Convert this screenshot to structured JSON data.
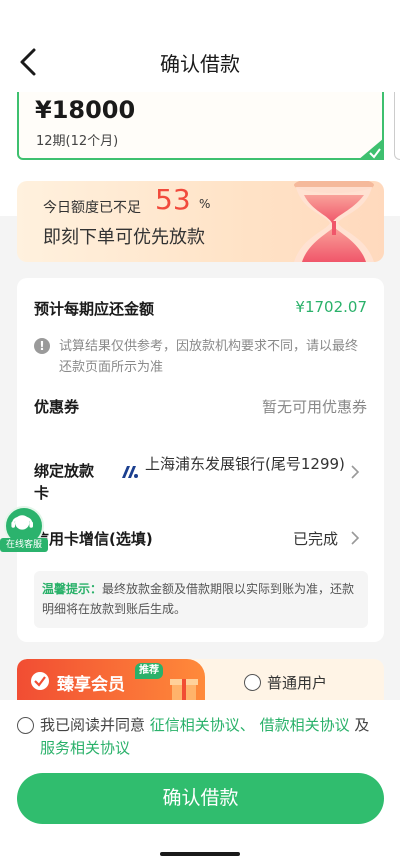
{
  "header": {
    "title": "确认借款"
  },
  "loan": {
    "amount": "¥18000",
    "term": "12期(12个月)"
  },
  "promo": {
    "line1": "今日额度已不足",
    "percent": "53",
    "percent_sign": "%",
    "line2": "即刻下单可优先放款"
  },
  "details": {
    "monthly_label": "预计每期应还金额",
    "monthly_value": "¥1702.07",
    "note": "试算结果仅供参考，因放款机构要求不同，请以最终还款页面所示为准",
    "coupon_label": "优惠券",
    "coupon_value": "暂无可用优惠券",
    "card_label": "绑定放款卡",
    "card_bank": "上海浦东发展银行(尾号1299)",
    "credit_label": "信用卡增信(选填)",
    "credit_value": "已完成",
    "tip_label": "温馨提示：",
    "tip_text": "最终放款金额及借款期限以实际到账为准，还款明细将在放款到账后生成。"
  },
  "customer_service": {
    "label": "在线客服"
  },
  "membership": {
    "vip_label": "臻享会员",
    "vip_tag": "推荐",
    "normal_label": "普通用户"
  },
  "agreement": {
    "prefix": "我已阅读并同意 ",
    "link1": "征信相关协议",
    "sep": "、 ",
    "link2": "借款相关协议",
    "and": " 及 ",
    "link3": "服务相关协议"
  },
  "confirm_button": "确认借款",
  "colors": {
    "accent": "#30bd6e",
    "warning": "#f14a3c",
    "vip": "#f14d33"
  }
}
